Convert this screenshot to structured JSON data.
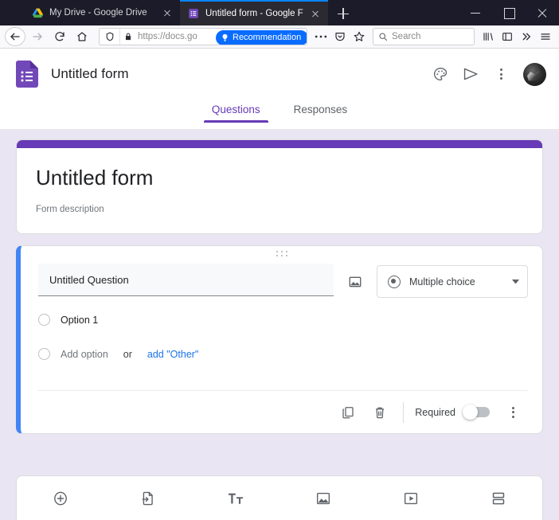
{
  "browser": {
    "tabs": [
      {
        "title": "My Drive - Google Drive",
        "favicon": "google-drive-icon",
        "active": false
      },
      {
        "title": "Untitled form - Google Forms",
        "favicon": "google-forms-icon",
        "active": true
      }
    ],
    "new_tab_label": "+",
    "window_controls": {
      "minimize": "minimize-icon",
      "maximize": "maximize-icon",
      "close": "close-icon"
    },
    "toolbar": {
      "back": "back-arrow-icon",
      "forward": "forward-arrow-icon",
      "reload": "reload-icon",
      "home": "home-icon",
      "shield": "tracking-protection-icon",
      "lock": "padlock-icon",
      "url": "https://docs.go",
      "recommendation_badge": "Recommendation",
      "recommendation_icon": "lightbulb-icon",
      "page_actions": "ellipsis-icon",
      "pocket": "pocket-icon",
      "bookmark": "star-icon",
      "search_placeholder": "Search",
      "search_icon": "magnifier-icon",
      "library": "library-icon",
      "sidebar": "sidebar-icon",
      "overflow": "chevrons-right-icon",
      "menu": "hamburger-menu-icon"
    }
  },
  "app": {
    "logo": "google-forms-logo",
    "title": "Untitled form",
    "header_icons": {
      "theme": "palette-icon",
      "preview_send": "send-icon",
      "more": "more-vertical-icon",
      "account": "user-avatar"
    },
    "tabs": [
      {
        "label": "Questions",
        "active": true
      },
      {
        "label": "Responses",
        "active": false
      }
    ]
  },
  "form": {
    "accent_color": "#673AB7",
    "active_border_color": "#4285F4",
    "canvas_color": "#E9E5F2",
    "link_color": "#1A73E8",
    "title": "Untitled form",
    "description": "Form description"
  },
  "question": {
    "drag_handle": "drag-handle-icon",
    "title": "Untitled Question",
    "add_image_icon": "image-icon",
    "type": {
      "icon": "radio-button-icon",
      "label": "Multiple choice",
      "caret": "chevron-down-icon"
    },
    "options": [
      {
        "label": "Option 1",
        "muted": false
      }
    ],
    "add_option": {
      "label": "Add option",
      "or": "or",
      "other_link": "add \"Other\""
    },
    "footer": {
      "duplicate_icon": "duplicate-icon",
      "delete_icon": "trash-icon",
      "required_label": "Required",
      "required_on": false,
      "more_icon": "more-vertical-icon"
    }
  },
  "bottom_toolbar": {
    "items": [
      {
        "name": "add-question-icon",
        "title": "Add question"
      },
      {
        "name": "import-questions-icon",
        "title": "Import questions"
      },
      {
        "name": "add-title-description-icon",
        "title": "Add title and description"
      },
      {
        "name": "add-image-icon",
        "title": "Add image"
      },
      {
        "name": "add-video-icon",
        "title": "Add video"
      },
      {
        "name": "add-section-icon",
        "title": "Add section"
      }
    ]
  }
}
